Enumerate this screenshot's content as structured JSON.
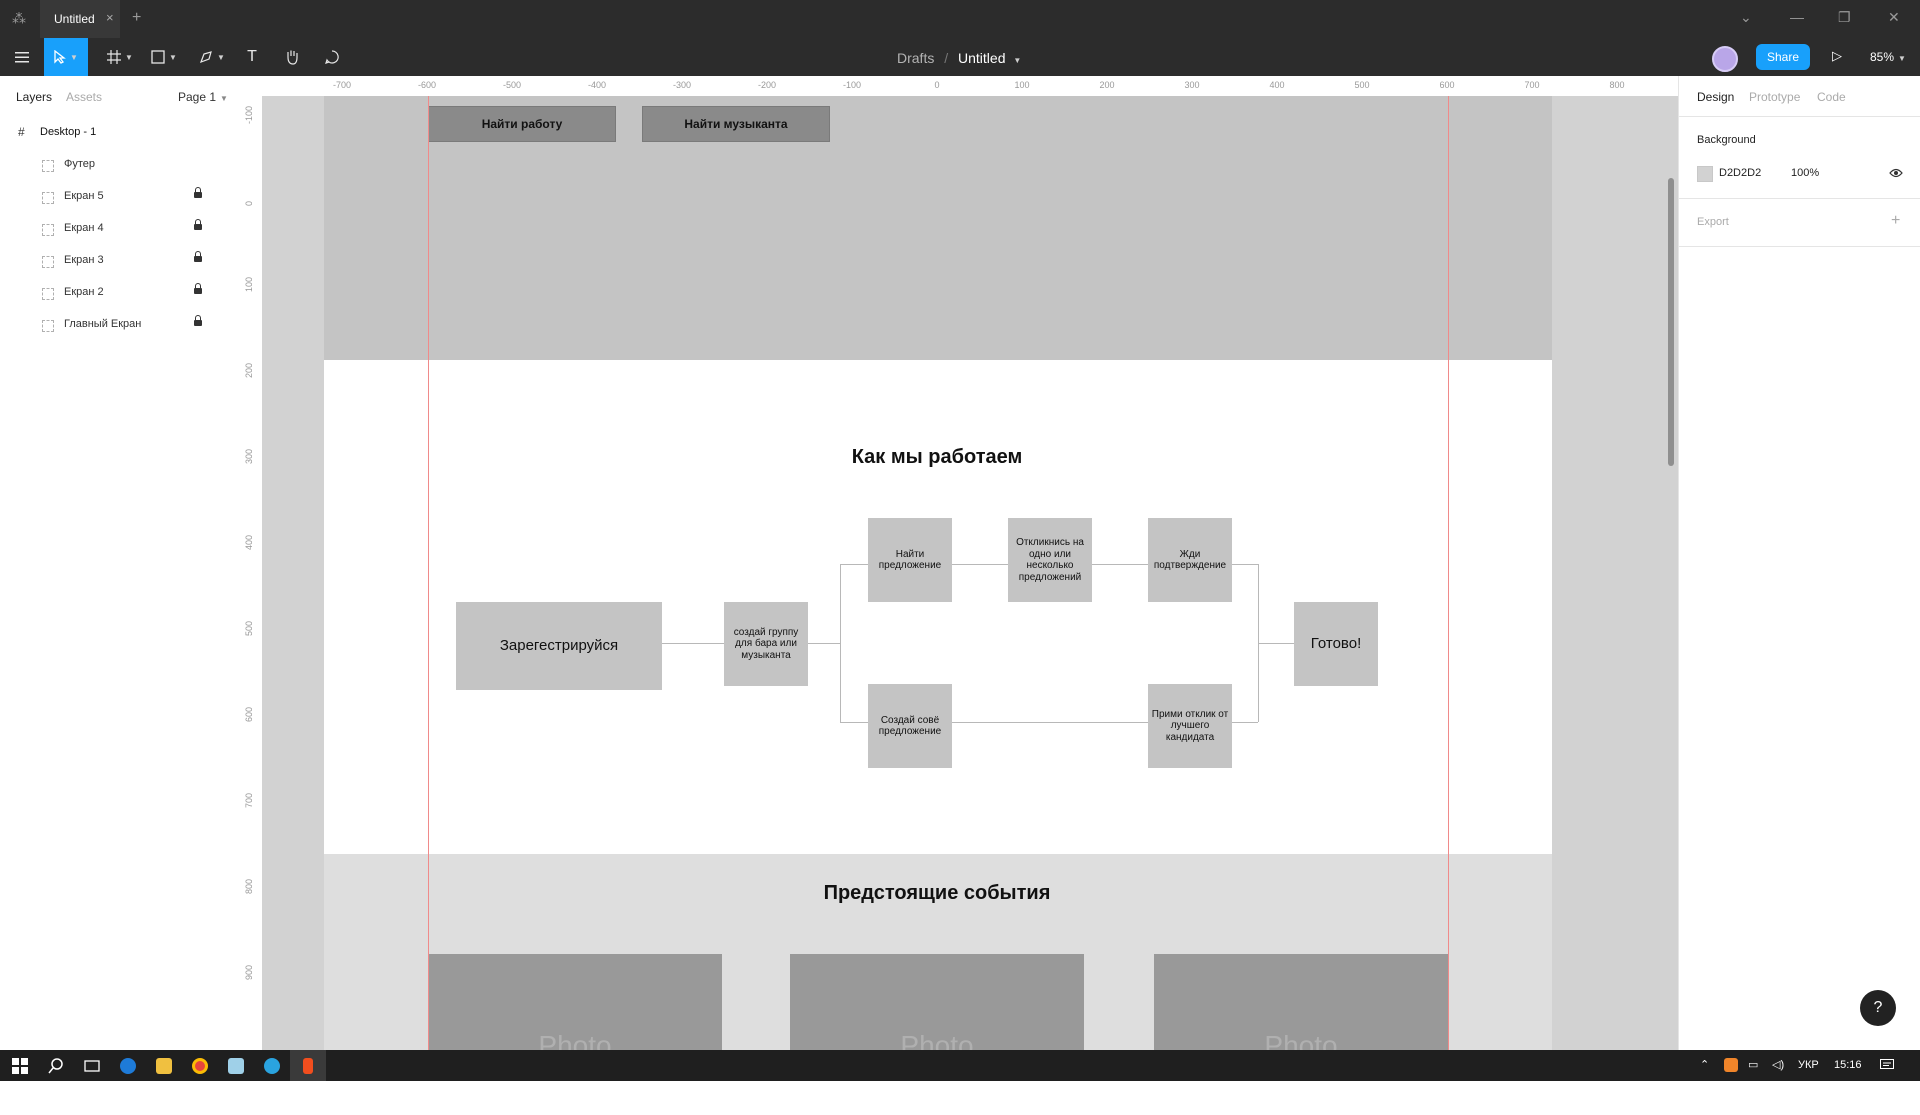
{
  "titlebar": {
    "tab_title": "Untitled",
    "tab_close": "×",
    "new_tab": "+",
    "minimize": "—",
    "maximize": "❐",
    "close": "✕",
    "chevron": "⌄"
  },
  "toolbar": {
    "breadcrumb_root": "Drafts",
    "breadcrumb_sep": "/",
    "file_name": "Untitled",
    "share_label": "Share",
    "zoom": "85%"
  },
  "left_panel": {
    "tabs": [
      "Layers",
      "Assets"
    ],
    "page": "Page 1",
    "frame_name": "Desktop - 1",
    "layers": [
      {
        "name": "Футер",
        "locked": false
      },
      {
        "name": "Екран 5",
        "locked": true
      },
      {
        "name": "Екран 4",
        "locked": true
      },
      {
        "name": "Екран 3",
        "locked": true
      },
      {
        "name": "Екран 2",
        "locked": true
      },
      {
        "name": "Главный Екран",
        "locked": true
      }
    ]
  },
  "ruler": {
    "h": [
      "-700",
      "-600",
      "-500",
      "-400",
      "-300",
      "-200",
      "-100",
      "0",
      "100",
      "200",
      "300",
      "400",
      "500",
      "600",
      "700",
      "800"
    ],
    "v": [
      "-100",
      "0",
      "100",
      "200",
      "300",
      "400",
      "500",
      "600",
      "700",
      "800",
      "900"
    ]
  },
  "canvas": {
    "hero_buttons": [
      "Найти работу",
      "Найти музыканта"
    ],
    "how_title": "Как мы работаем",
    "steps": {
      "register": "Зарегестрируйся",
      "create_group": "создай группу для бара или музыканта",
      "find_offer": "Найти предложение",
      "respond": "Откликнись на одно или несколько предложений",
      "wait": "Жди подтверждение",
      "create_offer": "Создай совё предложение",
      "accept": "Прими отклик от лучшего кандидата",
      "done": "Готово!"
    },
    "events_title": "Предстоящие события",
    "photo_label": "Photo"
  },
  "right_panel": {
    "tabs": [
      "Design",
      "Prototype",
      "Code"
    ],
    "background_label": "Background",
    "bg_hex": "D2D2D2",
    "bg_opacity": "100%",
    "export_label": "Export",
    "add": "+"
  },
  "help": "?",
  "taskbar": {
    "lang": "УКР",
    "time": "15:16"
  },
  "colors": {
    "accent": "#18a0fb",
    "canvas": "#d2d2d2",
    "guide": "#f08a8a"
  }
}
